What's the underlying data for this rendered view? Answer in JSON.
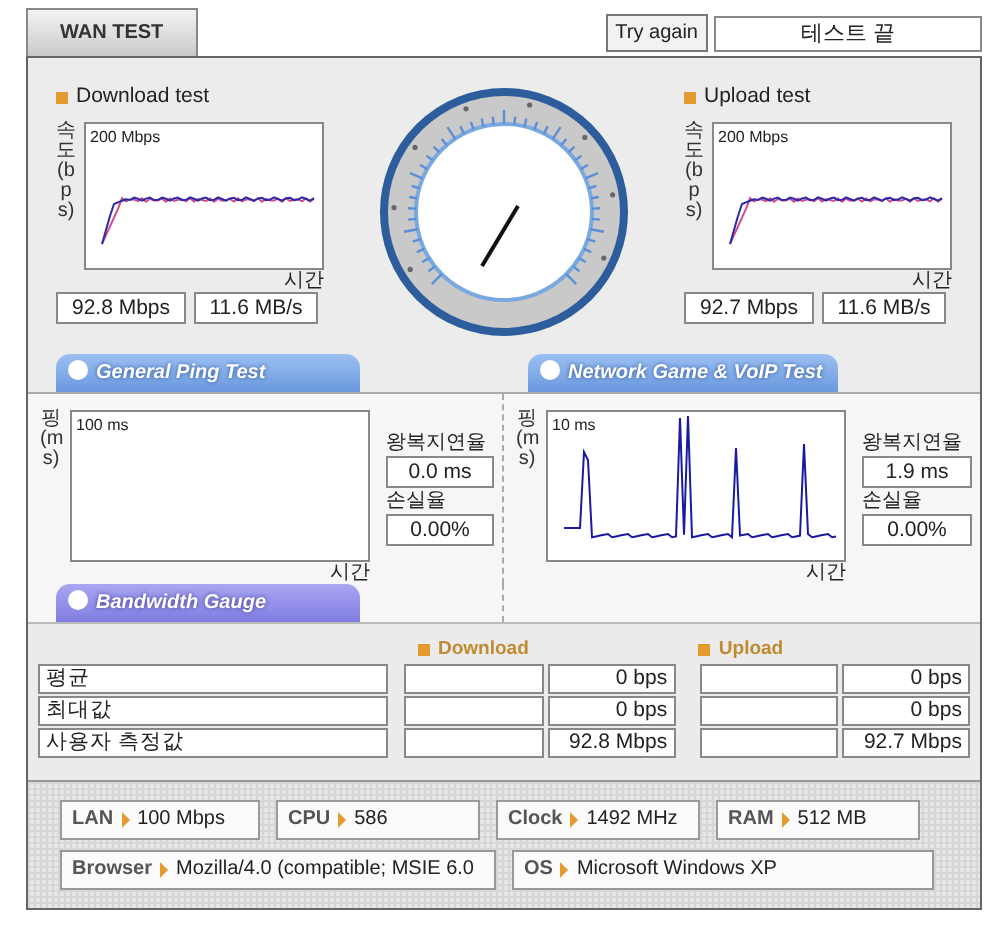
{
  "tabs": [
    {
      "label": "WAN TEST",
      "selected": true
    }
  ],
  "try_again_button": "Try again",
  "status_field": "테스트 끝",
  "speed_tests": [
    {
      "title": "Download test",
      "axis_label": "속도(bps)",
      "scale": "200 Mbps",
      "x_label": "시간",
      "rate": "92.8 Mbps",
      "bytes": "11.6 MB/s"
    },
    {
      "title": "Upload test",
      "axis_label": "속도(bps)",
      "scale": "200 Mbps",
      "x_label": "시간",
      "rate": "92.7 Mbps",
      "bytes": "11.6 MB/s"
    }
  ],
  "section_tabs": [
    {
      "label": "General Ping Test"
    },
    {
      "label": "Network Game & VoIP Test"
    }
  ],
  "ping_panels": [
    {
      "axis_label": "핑(ms)",
      "scale": "100 ms",
      "x_label": "시간",
      "latency_label": "왕복지연율",
      "latency": "0.0 ms",
      "loss_label": "손실율",
      "loss": "0.00%",
      "kind": "empty"
    },
    {
      "axis_label": "핑(ms)",
      "scale": "10 ms",
      "x_label": "시간",
      "latency_label": "왕복지연율",
      "latency": "1.9 ms",
      "loss_label": "손실율",
      "loss": "0.00%",
      "kind": "spikes"
    }
  ],
  "bandwidth": {
    "tab": "Bandwidth Gauge",
    "columns": [
      "Download",
      "Upload"
    ],
    "rows": [
      {
        "label": "평균",
        "download": "0 bps",
        "upload": "0 bps"
      },
      {
        "label": "최대값",
        "download": "0 bps",
        "upload": "0 bps"
      },
      {
        "label": "사용자 측정값",
        "download": "92.8 Mbps",
        "upload": "92.7 Mbps"
      }
    ]
  },
  "system_info": [
    [
      {
        "label": "LAN",
        "value": "100 Mbps"
      },
      {
        "label": "CPU",
        "value": "586"
      },
      {
        "label": "Clock",
        "value": "1492 MHz"
      },
      {
        "label": "RAM",
        "value": "512 MB"
      }
    ],
    [
      {
        "label": "Browser",
        "value": "Mozilla/4.0 (compatible; MSIE 6.0"
      },
      {
        "label": "OS",
        "value": "Microsoft Windows XP"
      }
    ]
  ]
}
